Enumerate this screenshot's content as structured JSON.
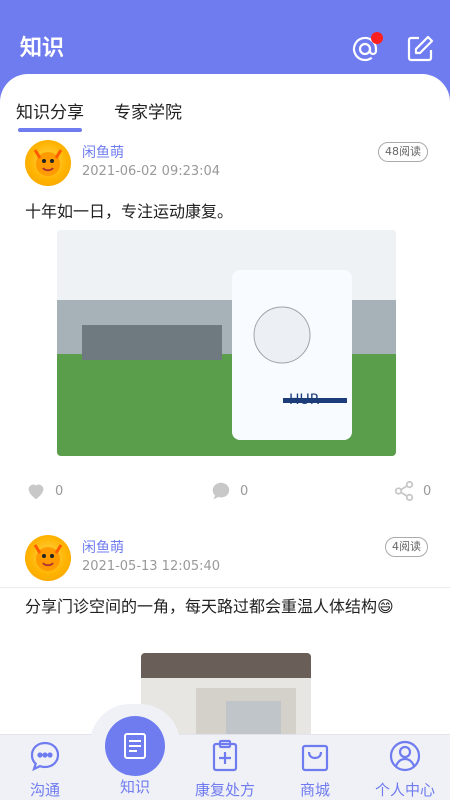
{
  "header": {
    "title": "知识",
    "icons": [
      "at-icon",
      "edit-icon"
    ],
    "accent_color": "#6f7cf0",
    "notification_color": "#ff1f1f"
  },
  "tabs": [
    {
      "label": "知识分享",
      "active": true
    },
    {
      "label": "专家学院",
      "active": false
    }
  ],
  "posts": [
    {
      "username": "闲鱼萌",
      "timestamp": "2021-06-02 09:23:04",
      "read_count": "48阅读",
      "text": "十年如一日，专注运动康复。",
      "likes": "0",
      "comments": "0",
      "shares": "0",
      "image_brand": "HUR"
    },
    {
      "username": "闲鱼萌",
      "timestamp": "2021-05-13 12:05:40",
      "read_count": "4阅读",
      "text": "分享门诊空间的一角，每天路过都会重温人体结构😄"
    }
  ],
  "bottom_nav": [
    {
      "label": "沟通",
      "icon": "chat-icon"
    },
    {
      "label": "知识",
      "icon": "knowledge-icon",
      "active": true
    },
    {
      "label": "康复处方",
      "icon": "prescription-icon"
    },
    {
      "label": "商城",
      "icon": "shopping-bag-icon"
    },
    {
      "label": "个人中心",
      "icon": "profile-icon"
    }
  ]
}
